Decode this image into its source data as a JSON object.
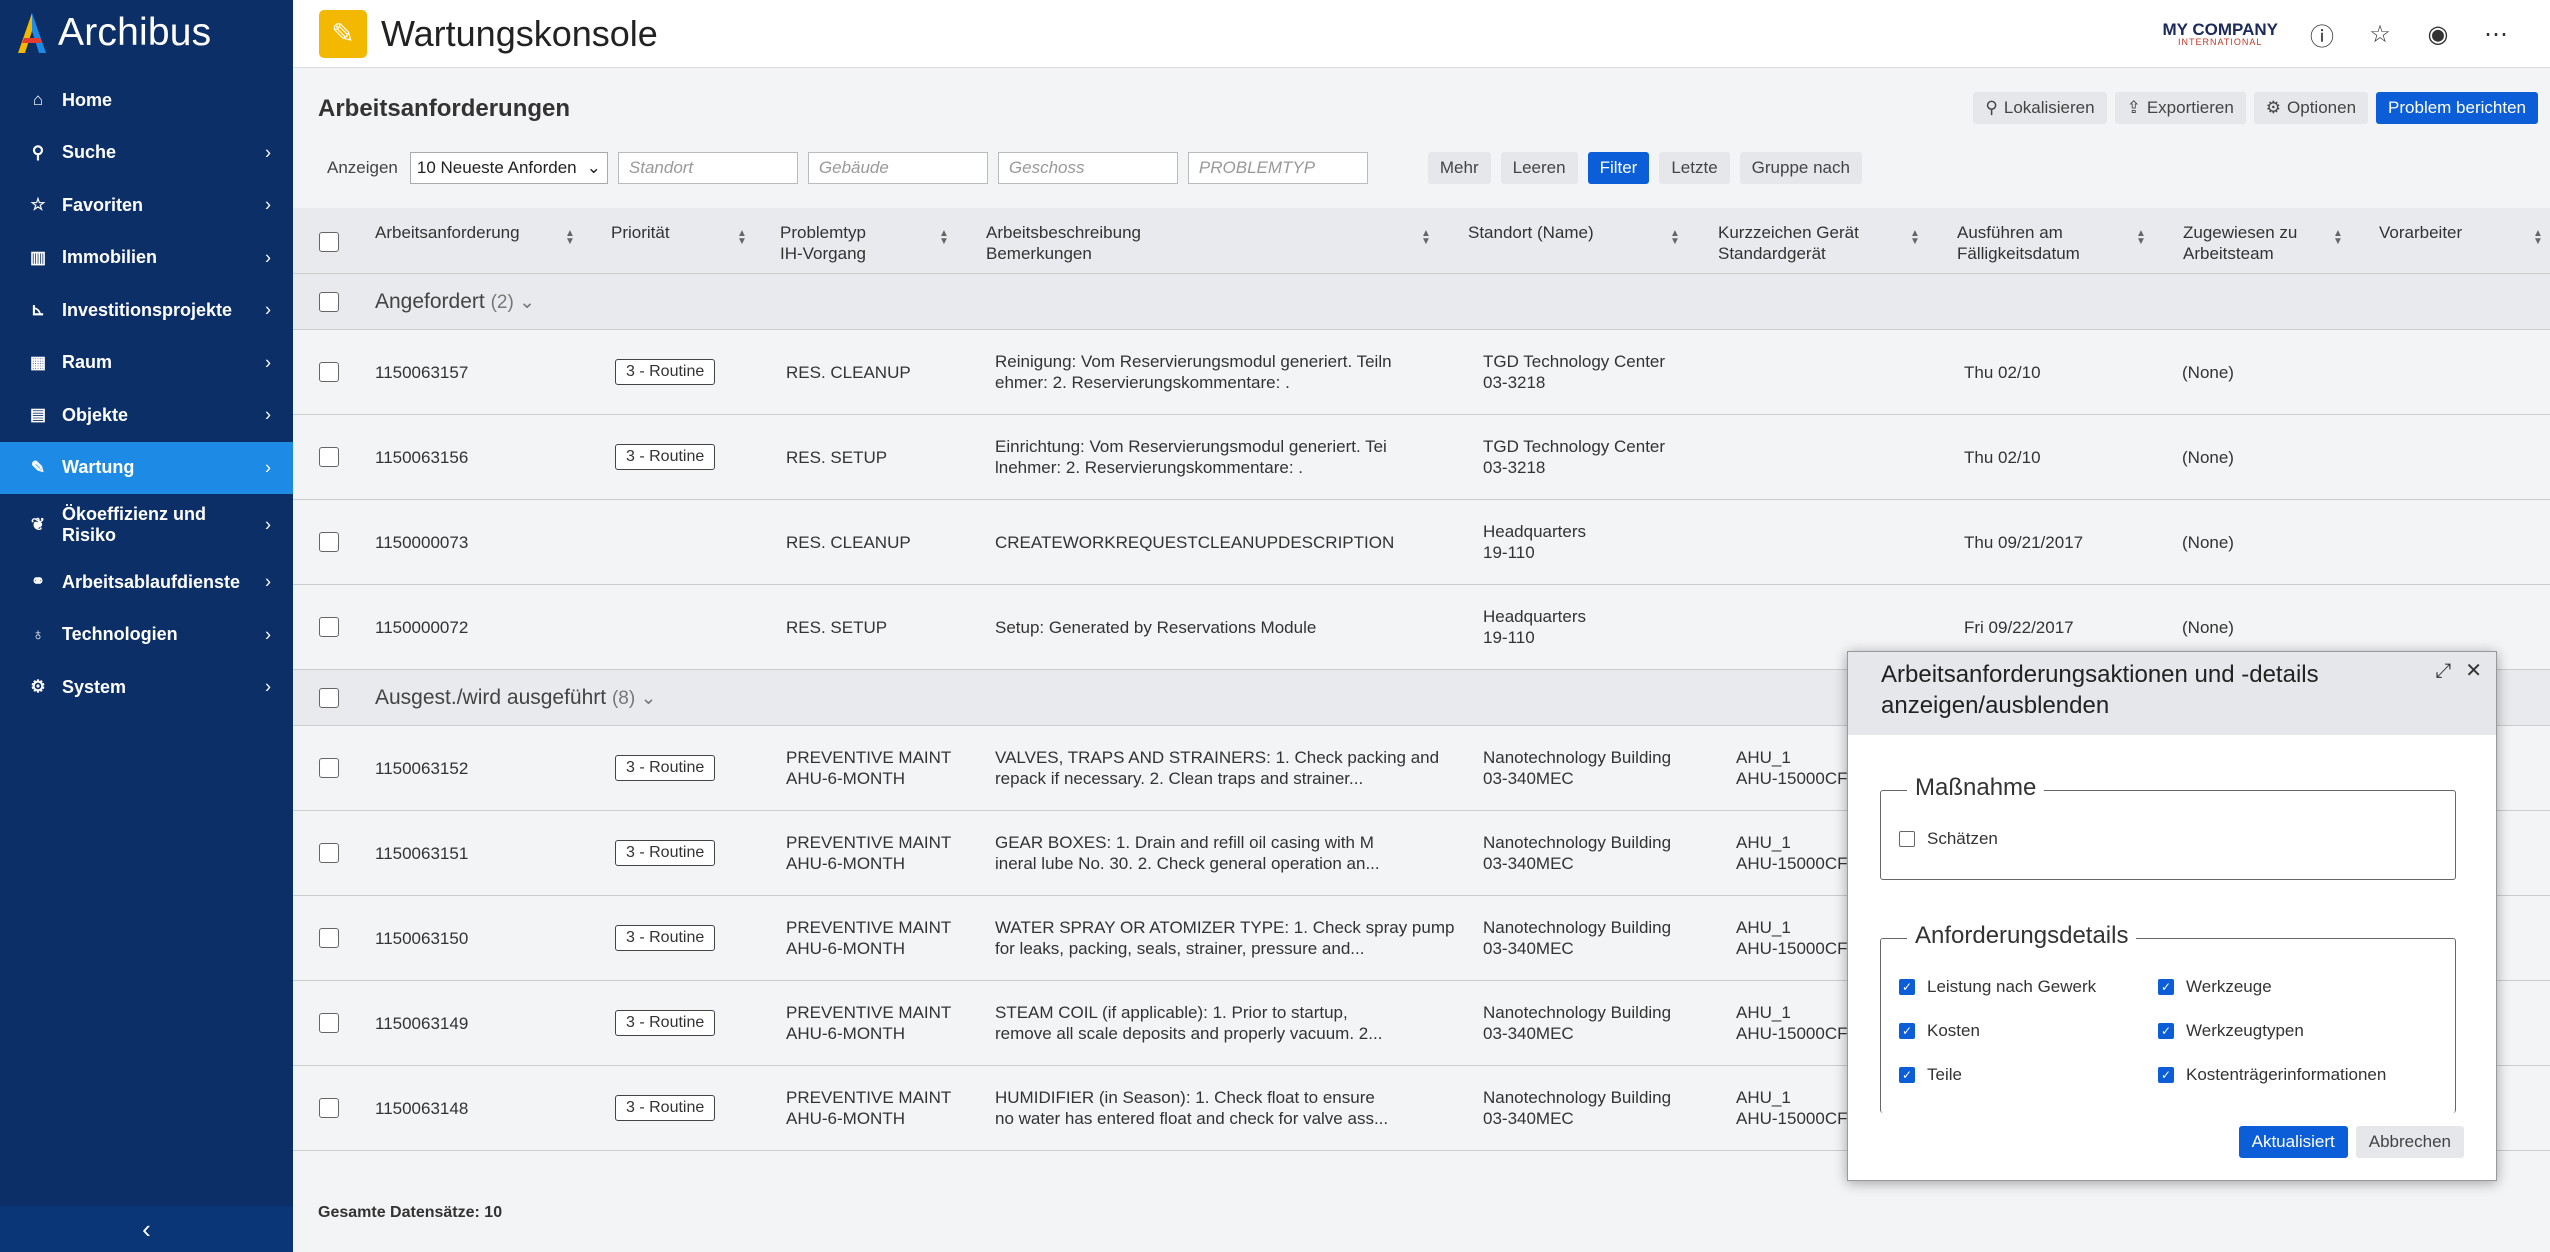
{
  "brand": {
    "name": "Archibus"
  },
  "sidebar": {
    "items": [
      {
        "label": "Home",
        "icon": "home-icon",
        "chevron": false
      },
      {
        "label": "Suche",
        "icon": "search-icon",
        "chevron": true
      },
      {
        "label": "Favoriten",
        "icon": "star-icon",
        "chevron": true
      },
      {
        "label": "Immobilien",
        "icon": "building-icon",
        "chevron": true
      },
      {
        "label": "Investitionsprojekte",
        "icon": "chart-icon",
        "chevron": true
      },
      {
        "label": "Raum",
        "icon": "floorplan-icon",
        "chevron": true
      },
      {
        "label": "Objekte",
        "icon": "clipboard-icon",
        "chevron": true
      },
      {
        "label": "Wartung",
        "icon": "wrench-icon",
        "chevron": true,
        "active": true
      },
      {
        "label": "Ökoeffizienz und Risiko",
        "icon": "leaf-icon",
        "chevron": true
      },
      {
        "label": "Arbeitsablaufdienste",
        "icon": "workflow-icon",
        "chevron": true
      },
      {
        "label": "Technologien",
        "icon": "lightbulb-icon",
        "chevron": true
      },
      {
        "label": "System",
        "icon": "gear-icon",
        "chevron": true
      }
    ]
  },
  "header": {
    "title": "Wartungskonsole",
    "company": "MY COMPANY",
    "company_sub": "INTERNATIONAL"
  },
  "panel": {
    "title": "Arbeitsanforderungen",
    "actions": {
      "locate": "Lokalisieren",
      "export": "Exportieren",
      "options": "Optionen",
      "report": "Problem berichten"
    }
  },
  "filter": {
    "show_label": "Anzeigen",
    "show_value": "10 Neueste Anforden",
    "location_placeholder": "Standort",
    "building_placeholder": "Gebäude",
    "floor_placeholder": "Geschoss",
    "problemtype_placeholder": "PROBLEMTYP",
    "more": "Mehr",
    "clear": "Leeren",
    "filter": "Filter",
    "last": "Letzte",
    "group_by": "Gruppe nach"
  },
  "table": {
    "columns": [
      {
        "line1": "Arbeitsanforderung",
        "line2": ""
      },
      {
        "line1": "Priorität",
        "line2": ""
      },
      {
        "line1": "Problemtyp",
        "line2": "IH-Vorgang"
      },
      {
        "line1": "Arbeitsbeschreibung",
        "line2": "Bemerkungen"
      },
      {
        "line1": "Standort (Name)",
        "line2": ""
      },
      {
        "line1": "Kurzzeichen Gerät",
        "line2": "Standardgerät"
      },
      {
        "line1": "Ausführen am",
        "line2": "Fälligkeitsdatum"
      },
      {
        "line1": "Zugewiesen zu",
        "line2": "Arbeitsteam"
      },
      {
        "line1": "Vorarbeiter",
        "line2": ""
      }
    ],
    "groups": [
      {
        "name": "Angefordert",
        "count": "(2)",
        "rows": [
          {
            "id": "1150063157",
            "priority": "3 - Routine",
            "problem1": "RES. CLEANUP",
            "problem2": "",
            "desc1": "Reinigung: Vom Reservierungsmodul generiert. Teiln",
            "desc2": "ehmer: 2. Reservierungskommentare: .",
            "loc1": "TGD Technology Center",
            "loc2": "03-3218",
            "eq1": "",
            "eq2": "",
            "date": "Thu 02/10",
            "assigned": "(None)"
          },
          {
            "id": "1150063156",
            "priority": "3 - Routine",
            "problem1": "RES. SETUP",
            "problem2": "",
            "desc1": "Einrichtung: Vom Reservierungsmodul generiert. Tei",
            "desc2": "lnehmer: 2. Reservierungskommentare: .",
            "loc1": "TGD Technology Center",
            "loc2": "03-3218",
            "eq1": "",
            "eq2": "",
            "date": "Thu 02/10",
            "assigned": "(None)"
          },
          {
            "id": "1150000073",
            "priority": "",
            "problem1": "RES. CLEANUP",
            "problem2": "",
            "desc1": "CREATEWORKREQUESTCLEANUPDESCRIPTION",
            "desc2": "",
            "loc1": "Headquarters",
            "loc2": "19-110",
            "eq1": "",
            "eq2": "",
            "date": "Thu 09/21/2017",
            "assigned": "(None)"
          },
          {
            "id": "1150000072",
            "priority": "",
            "problem1": "RES. SETUP",
            "problem2": "",
            "desc1": "Setup: Generated by Reservations Module",
            "desc2": "",
            "loc1": "Headquarters",
            "loc2": "19-110",
            "eq1": "",
            "eq2": "",
            "date": "Fri 09/22/2017",
            "assigned": "(None)"
          }
        ]
      },
      {
        "name": "Ausgest./wird ausgeführt",
        "count": "(8)",
        "rows": [
          {
            "id": "1150063152",
            "priority": "3 - Routine",
            "problem1": "PREVENTIVE MAINT",
            "problem2": "AHU-6-MONTH",
            "desc1": "VALVES, TRAPS AND STRAINERS: 1. Check packing and",
            "desc2": "repack if necessary. 2. Clean traps and strainer...",
            "loc1": "Nanotechnology Building",
            "loc2": "03-340MEC",
            "eq1": "AHU_1",
            "eq2": "AHU-15000CFM",
            "date": "",
            "assigned": ""
          },
          {
            "id": "1150063151",
            "priority": "3 - Routine",
            "problem1": "PREVENTIVE MAINT",
            "problem2": "AHU-6-MONTH",
            "desc1": "GEAR BOXES: 1. Drain and refill oil casing with M",
            "desc2": "ineral lube No. 30. 2. Check general operation an...",
            "loc1": "Nanotechnology Building",
            "loc2": "03-340MEC",
            "eq1": "AHU_1",
            "eq2": "AHU-15000CFM",
            "date": "",
            "assigned": ""
          },
          {
            "id": "1150063150",
            "priority": "3 - Routine",
            "problem1": "PREVENTIVE MAINT",
            "problem2": "AHU-6-MONTH",
            "desc1": "WATER SPRAY OR ATOMIZER TYPE: 1. Check spray pump",
            "desc2": "for leaks, packing, seals, strainer, pressure and...",
            "loc1": "Nanotechnology Building",
            "loc2": "03-340MEC",
            "eq1": "AHU_1",
            "eq2": "AHU-15000CFM",
            "date": "",
            "assigned": ""
          },
          {
            "id": "1150063149",
            "priority": "3 - Routine",
            "problem1": "PREVENTIVE MAINT",
            "problem2": "AHU-6-MONTH",
            "desc1": "STEAM COIL (if applicable): 1. Prior to startup,",
            "desc2": "remove all scale deposits and properly vacuum. 2...",
            "loc1": "Nanotechnology Building",
            "loc2": "03-340MEC",
            "eq1": "AHU_1",
            "eq2": "AHU-15000CFM",
            "date": "",
            "assigned": ""
          },
          {
            "id": "1150063148",
            "priority": "3 - Routine",
            "problem1": "PREVENTIVE MAINT",
            "problem2": "AHU-6-MONTH",
            "desc1": "HUMIDIFIER (in Season): 1. Check float to ensure",
            "desc2": "no water has entered float and check for valve ass...",
            "loc1": "Nanotechnology Building",
            "loc2": "03-340MEC",
            "eq1": "AHU_1",
            "eq2": "AHU-15000CFM",
            "date": "",
            "assigned": ""
          }
        ]
      }
    ],
    "footer": "Gesamte Datensätze: 10"
  },
  "dialog": {
    "title_line1": "Arbeitsanforderungsaktionen und -details",
    "title_line2": "anzeigen/ausblenden",
    "section1": {
      "legend": "Maßnahme",
      "items": [
        {
          "label": "Schätzen",
          "checked": false
        }
      ]
    },
    "section2": {
      "legend": "Anforderungsdetails",
      "items": [
        {
          "label": "Leistung nach Gewerk",
          "checked": true
        },
        {
          "label": "Werkzeuge",
          "checked": true
        },
        {
          "label": "Kosten",
          "checked": true
        },
        {
          "label": "Werkzeugtypen",
          "checked": true
        },
        {
          "label": "Teile",
          "checked": true
        },
        {
          "label": "Kostenträgerinformationen",
          "checked": true
        }
      ]
    },
    "update": "Aktualisiert",
    "cancel": "Abbrechen"
  },
  "colors": {
    "sidebar": "#0b2f66",
    "active": "#1d8be6",
    "primary": "#0b5ed7",
    "app_icon": "#f3b800"
  }
}
